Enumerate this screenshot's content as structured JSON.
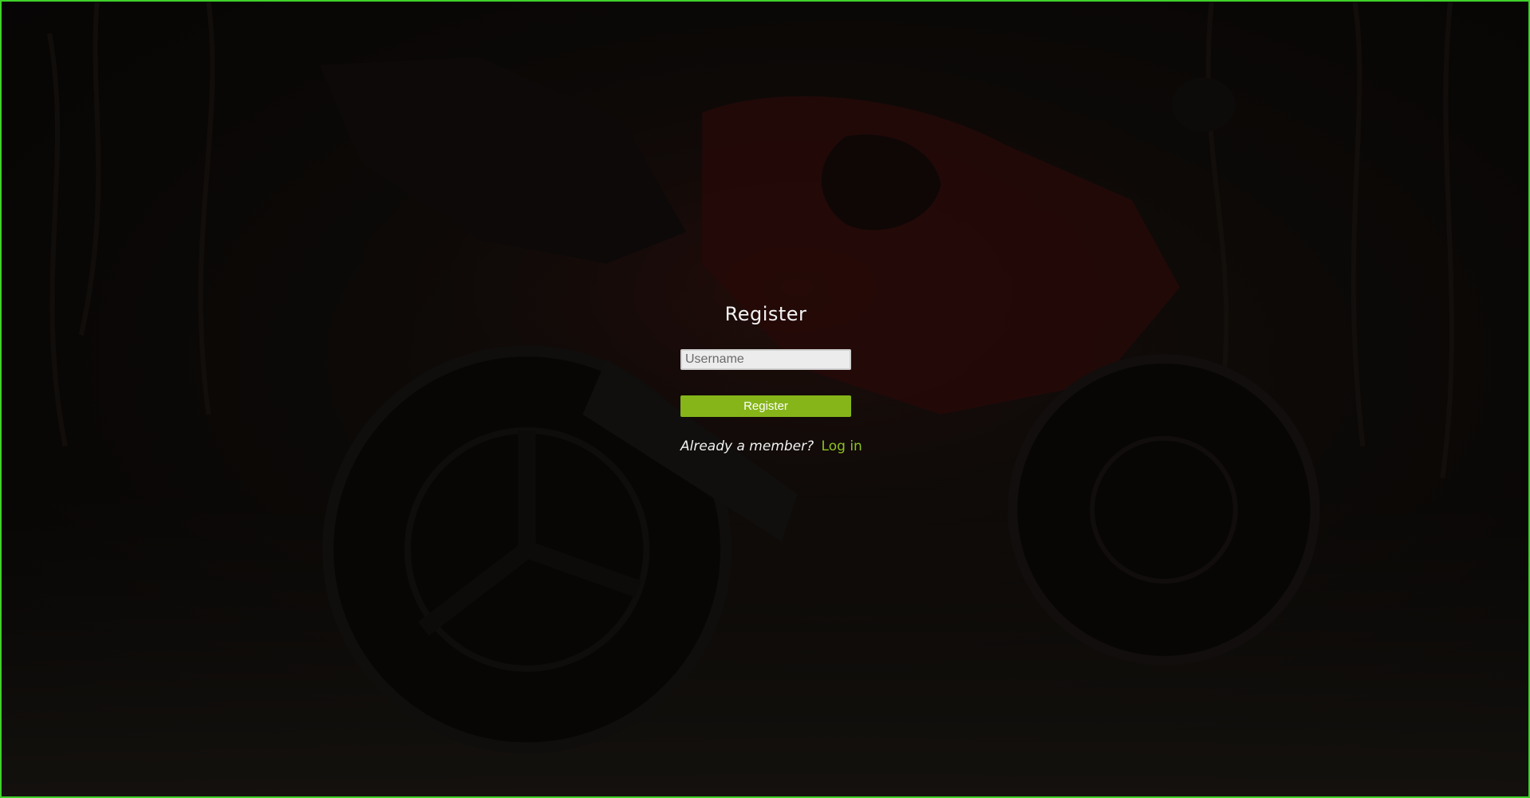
{
  "register_form": {
    "title": "Register",
    "username_placeholder": "Username",
    "username_value": "",
    "submit_label": "Register",
    "member_prompt": "Already a member?",
    "login_link": "Log in"
  },
  "colors": {
    "accent": "#86b51a",
    "link": "#8dc21f",
    "frame_border": "#3fd12a",
    "background": "#120e0b"
  },
  "background": {
    "subject": "red sport motorcycle photo, darkened"
  }
}
